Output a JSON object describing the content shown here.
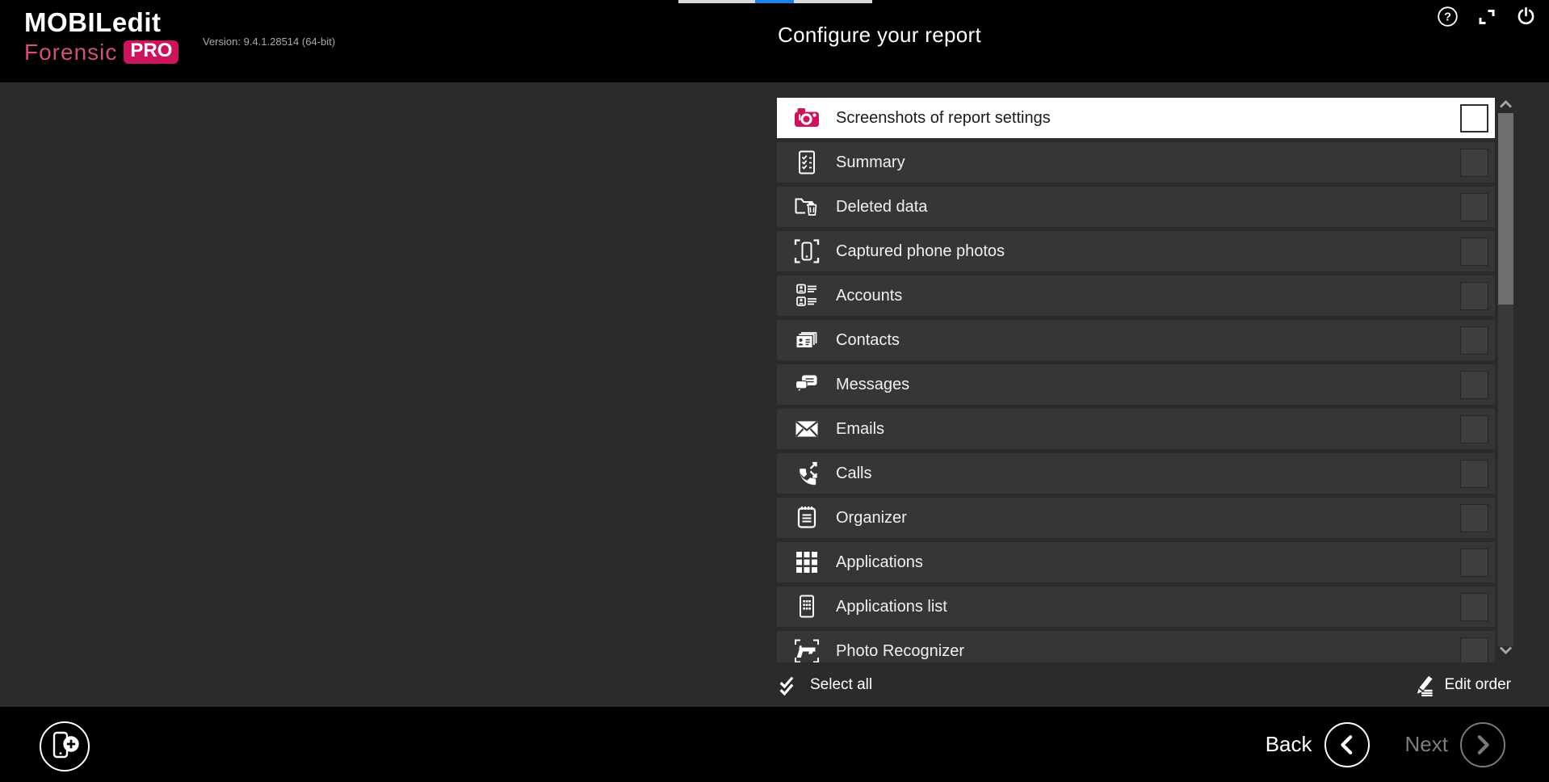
{
  "brand": {
    "name": "MOBILedit",
    "product": "Forensic",
    "edition": "PRO",
    "version": "Version: 9.4.1.28514 (64-bit)",
    "accent_color": "#cc145c"
  },
  "header": {
    "title": "Configure your report",
    "icons": [
      "help-icon",
      "snap-corners-icon",
      "power-icon"
    ],
    "top_strip": {
      "base_color": "#d9d9d9",
      "accent_color": "#1d82e9"
    }
  },
  "report_items": [
    {
      "label": "Screenshots of report settings",
      "icon": "camera",
      "selected": true,
      "checked": false
    },
    {
      "label": "Summary",
      "icon": "summary-document",
      "selected": false,
      "checked": false
    },
    {
      "label": "Deleted data",
      "icon": "deleted-data",
      "selected": false,
      "checked": false
    },
    {
      "label": "Captured phone photos",
      "icon": "captured-phone",
      "selected": false,
      "checked": false
    },
    {
      "label": "Accounts",
      "icon": "accounts",
      "selected": false,
      "checked": false
    },
    {
      "label": "Contacts",
      "icon": "contacts",
      "selected": false,
      "checked": false
    },
    {
      "label": "Messages",
      "icon": "messages",
      "selected": false,
      "checked": false
    },
    {
      "label": "Emails",
      "icon": "emails",
      "selected": false,
      "checked": false
    },
    {
      "label": "Calls",
      "icon": "calls",
      "selected": false,
      "checked": false
    },
    {
      "label": "Organizer",
      "icon": "organizer",
      "selected": false,
      "checked": false
    },
    {
      "label": "Applications",
      "icon": "applications-grid",
      "selected": false,
      "checked": false
    },
    {
      "label": "Applications list",
      "icon": "applications-list",
      "selected": false,
      "checked": false
    },
    {
      "label": "Photo Recognizer",
      "icon": "photo-recognizer",
      "selected": false,
      "checked": false
    }
  ],
  "list_actions": {
    "select_all": "Select all",
    "edit_order": "Edit order"
  },
  "footer": {
    "back": "Back",
    "next": "Next",
    "next_enabled": false
  },
  "colors": {
    "header_bg": "#000000",
    "content_bg": "#2b2b2b",
    "row_bg": "#363636",
    "selected_row_bg": "#ffffff",
    "scroll_thumb": "#6f6f6f"
  }
}
